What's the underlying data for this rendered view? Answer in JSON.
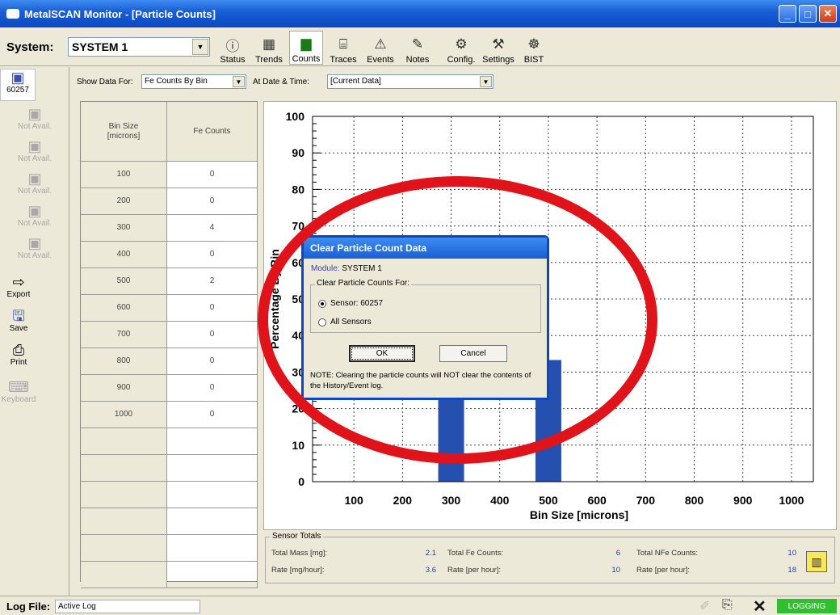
{
  "window": {
    "title": "MetalSCAN Monitor - [Particle Counts]"
  },
  "toolbar": {
    "system_label": "System:",
    "system_value": "SYSTEM 1",
    "buttons": [
      {
        "label": "Status",
        "icon": "info-icon"
      },
      {
        "label": "Trends",
        "icon": "trends-icon"
      },
      {
        "label": "Counts",
        "icon": "bar-chart-icon",
        "active": true
      },
      {
        "label": "Traces",
        "icon": "traces-icon"
      },
      {
        "label": "Events",
        "icon": "warning-icon"
      },
      {
        "label": "Notes",
        "icon": "notes-icon"
      },
      {
        "label": "Config.",
        "icon": "config-icon"
      },
      {
        "label": "Settings",
        "icon": "settings-icon"
      },
      {
        "label": "BIST",
        "icon": "bist-icon"
      }
    ]
  },
  "sidebar": {
    "sensors": [
      {
        "label": "60257",
        "active": true
      },
      {
        "label": "Not Avail."
      },
      {
        "label": "Not Avail."
      },
      {
        "label": "Not Avail."
      },
      {
        "label": "Not Avail."
      },
      {
        "label": "Not Avail."
      }
    ],
    "actions": [
      {
        "label": "Export",
        "icon": "arrow-right-icon"
      },
      {
        "label": "Save",
        "icon": "floppy-icon"
      },
      {
        "label": "Print",
        "icon": "printer-icon"
      },
      {
        "label": "Keyboard",
        "icon": "keyboard-icon",
        "disabled": true
      }
    ]
  },
  "controls": {
    "show_label": "Show Data For:",
    "show_value": "Fe Counts By Bin",
    "date_label": "At Date & Time:",
    "date_value": "[Current Data]"
  },
  "table": {
    "headers": [
      "Bin Size\n[microns]",
      "Fe Counts"
    ],
    "rows": [
      [
        "100",
        "0"
      ],
      [
        "200",
        "0"
      ],
      [
        "300",
        "4"
      ],
      [
        "400",
        "0"
      ],
      [
        "500",
        "2"
      ],
      [
        "600",
        "0"
      ],
      [
        "700",
        "0"
      ],
      [
        "800",
        "0"
      ],
      [
        "900",
        "0"
      ],
      [
        "1000",
        "0"
      ]
    ],
    "empty_rows": 6
  },
  "chart_data": {
    "type": "bar",
    "xlabel": "Bin Size [microns]",
    "ylabel": "Percentage By Bin",
    "categories": [
      "100",
      "200",
      "300",
      "400",
      "500",
      "600",
      "700",
      "800",
      "900",
      "1000"
    ],
    "values": [
      0,
      0,
      66.7,
      0,
      33.3,
      0,
      0,
      0,
      0,
      0
    ],
    "ylim": [
      0,
      100
    ],
    "yticks": [
      "0",
      "10",
      "20",
      "30",
      "40",
      "50",
      "60",
      "70",
      "80",
      "90",
      "100"
    ],
    "grid": true,
    "bar_color": "#2550b0"
  },
  "totals": {
    "legend": "Sensor Totals",
    "items": [
      {
        "label": "Total Mass [mg]:",
        "value": "2.1"
      },
      {
        "label": "Rate [mg/hour]:",
        "value": "3.6"
      },
      {
        "label": "Total Fe Counts:",
        "value": "6"
      },
      {
        "label": "Rate [per hour]:",
        "value": "10"
      },
      {
        "label": "Total NFe Counts:",
        "value": "10"
      },
      {
        "label": "Rate [per hour]:",
        "value": "18"
      }
    ]
  },
  "status": {
    "label": "Log File:",
    "value": "Active Log",
    "logging": "LOGGING",
    "logging_color": "#2fbf2f"
  },
  "dialog": {
    "title": "Clear Particle Count Data",
    "module_label": "Module:",
    "module_value": "SYSTEM 1",
    "group_label": "Clear Particle Counts For:",
    "option_sensor": "Sensor: 60257",
    "option_all": "All Sensors",
    "ok": "OK",
    "cancel": "Cancel",
    "note": "NOTE:  Clearing the particle counts will NOT clear the contents of the History/Event log."
  }
}
